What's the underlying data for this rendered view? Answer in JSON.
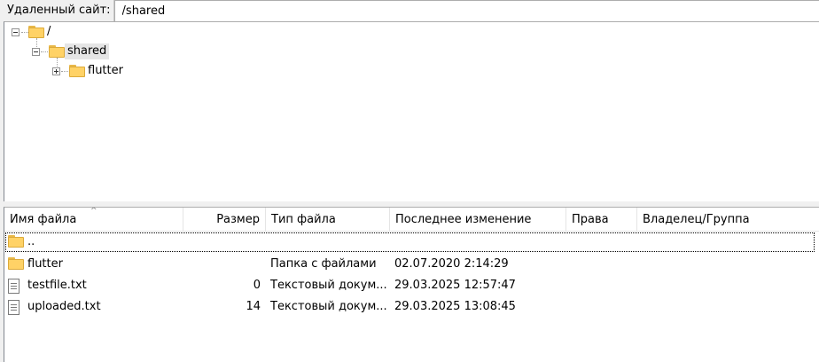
{
  "pathbar": {
    "label": "Удаленный сайт:",
    "path": "/shared"
  },
  "tree": {
    "root": "/",
    "shared": "shared",
    "flutter": "flutter"
  },
  "list": {
    "columns": {
      "name": "Имя файла",
      "size": "Размер",
      "type": "Тип файла",
      "modified": "Последнее изменение",
      "perms": "Права",
      "owner": "Владелец/Группа"
    },
    "sort_indicator": "^",
    "rows": [
      {
        "icon": "folder-icon",
        "name": "..",
        "size": "",
        "type": "",
        "modified": ""
      },
      {
        "icon": "folder-icon",
        "name": "flutter",
        "size": "",
        "type": "Папка с файлами",
        "modified": "02.07.2020 2:14:29"
      },
      {
        "icon": "text-file-icon",
        "name": "testfile.txt",
        "size": "0",
        "type": "Текстовый докум...",
        "modified": "29.03.2025 12:57:47"
      },
      {
        "icon": "text-file-icon",
        "name": "uploaded.txt",
        "size": "14",
        "type": "Текстовый докум...",
        "modified": "29.03.2025 13:08:45"
      }
    ]
  }
}
